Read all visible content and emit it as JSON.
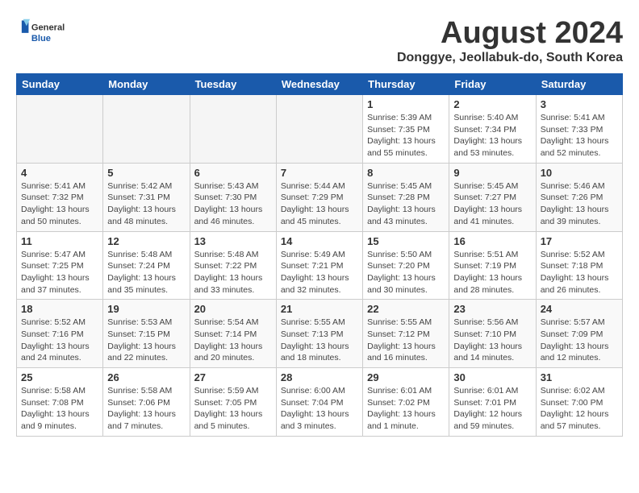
{
  "header": {
    "logo_general": "General",
    "logo_blue": "Blue",
    "month": "August 2024",
    "location": "Donggye, Jeollabuk-do, South Korea"
  },
  "weekdays": [
    "Sunday",
    "Monday",
    "Tuesday",
    "Wednesday",
    "Thursday",
    "Friday",
    "Saturday"
  ],
  "weeks": [
    [
      {
        "day": "",
        "info": ""
      },
      {
        "day": "",
        "info": ""
      },
      {
        "day": "",
        "info": ""
      },
      {
        "day": "",
        "info": ""
      },
      {
        "day": "1",
        "info": "Sunrise: 5:39 AM\nSunset: 7:35 PM\nDaylight: 13 hours\nand 55 minutes."
      },
      {
        "day": "2",
        "info": "Sunrise: 5:40 AM\nSunset: 7:34 PM\nDaylight: 13 hours\nand 53 minutes."
      },
      {
        "day": "3",
        "info": "Sunrise: 5:41 AM\nSunset: 7:33 PM\nDaylight: 13 hours\nand 52 minutes."
      }
    ],
    [
      {
        "day": "4",
        "info": "Sunrise: 5:41 AM\nSunset: 7:32 PM\nDaylight: 13 hours\nand 50 minutes."
      },
      {
        "day": "5",
        "info": "Sunrise: 5:42 AM\nSunset: 7:31 PM\nDaylight: 13 hours\nand 48 minutes."
      },
      {
        "day": "6",
        "info": "Sunrise: 5:43 AM\nSunset: 7:30 PM\nDaylight: 13 hours\nand 46 minutes."
      },
      {
        "day": "7",
        "info": "Sunrise: 5:44 AM\nSunset: 7:29 PM\nDaylight: 13 hours\nand 45 minutes."
      },
      {
        "day": "8",
        "info": "Sunrise: 5:45 AM\nSunset: 7:28 PM\nDaylight: 13 hours\nand 43 minutes."
      },
      {
        "day": "9",
        "info": "Sunrise: 5:45 AM\nSunset: 7:27 PM\nDaylight: 13 hours\nand 41 minutes."
      },
      {
        "day": "10",
        "info": "Sunrise: 5:46 AM\nSunset: 7:26 PM\nDaylight: 13 hours\nand 39 minutes."
      }
    ],
    [
      {
        "day": "11",
        "info": "Sunrise: 5:47 AM\nSunset: 7:25 PM\nDaylight: 13 hours\nand 37 minutes."
      },
      {
        "day": "12",
        "info": "Sunrise: 5:48 AM\nSunset: 7:24 PM\nDaylight: 13 hours\nand 35 minutes."
      },
      {
        "day": "13",
        "info": "Sunrise: 5:48 AM\nSunset: 7:22 PM\nDaylight: 13 hours\nand 33 minutes."
      },
      {
        "day": "14",
        "info": "Sunrise: 5:49 AM\nSunset: 7:21 PM\nDaylight: 13 hours\nand 32 minutes."
      },
      {
        "day": "15",
        "info": "Sunrise: 5:50 AM\nSunset: 7:20 PM\nDaylight: 13 hours\nand 30 minutes."
      },
      {
        "day": "16",
        "info": "Sunrise: 5:51 AM\nSunset: 7:19 PM\nDaylight: 13 hours\nand 28 minutes."
      },
      {
        "day": "17",
        "info": "Sunrise: 5:52 AM\nSunset: 7:18 PM\nDaylight: 13 hours\nand 26 minutes."
      }
    ],
    [
      {
        "day": "18",
        "info": "Sunrise: 5:52 AM\nSunset: 7:16 PM\nDaylight: 13 hours\nand 24 minutes."
      },
      {
        "day": "19",
        "info": "Sunrise: 5:53 AM\nSunset: 7:15 PM\nDaylight: 13 hours\nand 22 minutes."
      },
      {
        "day": "20",
        "info": "Sunrise: 5:54 AM\nSunset: 7:14 PM\nDaylight: 13 hours\nand 20 minutes."
      },
      {
        "day": "21",
        "info": "Sunrise: 5:55 AM\nSunset: 7:13 PM\nDaylight: 13 hours\nand 18 minutes."
      },
      {
        "day": "22",
        "info": "Sunrise: 5:55 AM\nSunset: 7:12 PM\nDaylight: 13 hours\nand 16 minutes."
      },
      {
        "day": "23",
        "info": "Sunrise: 5:56 AM\nSunset: 7:10 PM\nDaylight: 13 hours\nand 14 minutes."
      },
      {
        "day": "24",
        "info": "Sunrise: 5:57 AM\nSunset: 7:09 PM\nDaylight: 13 hours\nand 12 minutes."
      }
    ],
    [
      {
        "day": "25",
        "info": "Sunrise: 5:58 AM\nSunset: 7:08 PM\nDaylight: 13 hours\nand 9 minutes."
      },
      {
        "day": "26",
        "info": "Sunrise: 5:58 AM\nSunset: 7:06 PM\nDaylight: 13 hours\nand 7 minutes."
      },
      {
        "day": "27",
        "info": "Sunrise: 5:59 AM\nSunset: 7:05 PM\nDaylight: 13 hours\nand 5 minutes."
      },
      {
        "day": "28",
        "info": "Sunrise: 6:00 AM\nSunset: 7:04 PM\nDaylight: 13 hours\nand 3 minutes."
      },
      {
        "day": "29",
        "info": "Sunrise: 6:01 AM\nSunset: 7:02 PM\nDaylight: 13 hours\nand 1 minute."
      },
      {
        "day": "30",
        "info": "Sunrise: 6:01 AM\nSunset: 7:01 PM\nDaylight: 12 hours\nand 59 minutes."
      },
      {
        "day": "31",
        "info": "Sunrise: 6:02 AM\nSunset: 7:00 PM\nDaylight: 12 hours\nand 57 minutes."
      }
    ]
  ]
}
